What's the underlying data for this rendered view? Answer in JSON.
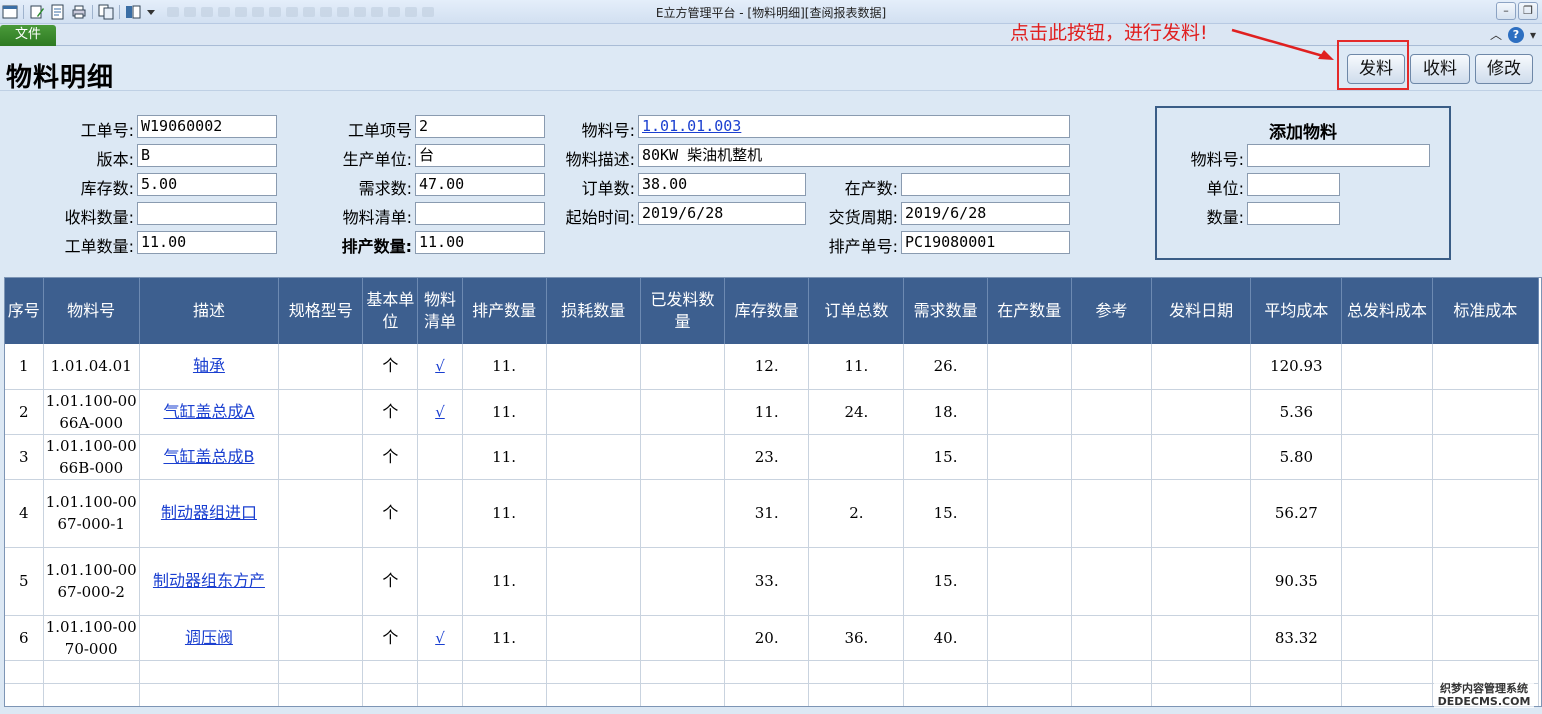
{
  "window": {
    "title": "E立方管理平台 - [物料明细][查阅报表数据]"
  },
  "ribbon": {
    "file_tab": "文件"
  },
  "page": {
    "title": "物料明细"
  },
  "annotation": {
    "text": "点击此按钮，进行发料!"
  },
  "actions": {
    "issue": "发料",
    "receive": "收料",
    "edit": "修改"
  },
  "form": {
    "work_order_no": {
      "label": "工单号:",
      "value": "W19060002"
    },
    "version": {
      "label": "版本:",
      "value": "B"
    },
    "stock_qty": {
      "label": "库存数:",
      "value": "5.00"
    },
    "received_qty": {
      "label": "收料数量:",
      "value": ""
    },
    "order_qty": {
      "label": "工单数量:",
      "value": "11.00"
    },
    "item_no": {
      "label": "工单项号",
      "value": "2"
    },
    "production_unit": {
      "label": "生产单位:",
      "value": "台"
    },
    "demand_qty": {
      "label": "需求数:",
      "value": "47.00"
    },
    "bom": {
      "label": "物料清单:",
      "value": ""
    },
    "scheduled_qty": {
      "label": "排产数量:",
      "value": "11.00"
    },
    "material_no": {
      "label": "物料号:",
      "value": "1.01.01.003"
    },
    "material_desc": {
      "label": "物料描述:",
      "value": "80KW 柴油机整机"
    },
    "order_count": {
      "label": "订单数:",
      "value": "38.00"
    },
    "start_time": {
      "label": "起始时间:",
      "value": "2019/6/28"
    },
    "in_production": {
      "label": "在产数:",
      "value": ""
    },
    "delivery": {
      "label": "交货周期:",
      "value": "2019/6/28"
    },
    "schedule_no": {
      "label": "排产单号:",
      "value": "PC19080001"
    }
  },
  "add_material": {
    "title": "添加物料",
    "material_no_label": "物料号:",
    "unit_label": "单位:",
    "qty_label": "数量:",
    "material_no": "",
    "unit": "",
    "qty": ""
  },
  "table": {
    "columns": [
      "序号",
      "物料号",
      "描述",
      "规格型号",
      "基本单位",
      "物料清单",
      "排产数量",
      "损耗数量",
      "已发料数量",
      "库存数量",
      "订单总数",
      "需求数量",
      "在产数量",
      "参考",
      "发料日期",
      "平均成本",
      "总发料成本",
      "标准成本"
    ],
    "rows": [
      {
        "seq": "1",
        "material_no": "1.01.04.01",
        "desc": "轴承",
        "spec": "",
        "unit": "个",
        "bom": "√",
        "sched": "11.",
        "loss": "",
        "issued": "",
        "stock": "12.",
        "orders": "11.",
        "demand": "26.",
        "inprod": "",
        "ref": "",
        "date": "",
        "avg": "120.93",
        "total": "",
        "std": ""
      },
      {
        "seq": "2",
        "material_no": "1.01.100-0066A-000",
        "desc": "气缸盖总成A",
        "spec": "",
        "unit": "个",
        "bom": "√",
        "sched": "11.",
        "loss": "",
        "issued": "",
        "stock": "11.",
        "orders": "24.",
        "demand": "18.",
        "inprod": "",
        "ref": "",
        "date": "",
        "avg": "5.36",
        "total": "",
        "std": ""
      },
      {
        "seq": "3",
        "material_no": "1.01.100-0066B-000",
        "desc": "气缸盖总成B",
        "spec": "",
        "unit": "个",
        "bom": "",
        "sched": "11.",
        "loss": "",
        "issued": "",
        "stock": "23.",
        "orders": "",
        "demand": "15.",
        "inprod": "",
        "ref": "",
        "date": "",
        "avg": "5.80",
        "total": "",
        "std": ""
      },
      {
        "seq": "4",
        "material_no": "1.01.100-0067-000-1",
        "desc": "制动器组进口",
        "spec": "",
        "unit": "个",
        "bom": "",
        "sched": "11.",
        "loss": "",
        "issued": "",
        "stock": "31.",
        "orders": "2.",
        "demand": "15.",
        "inprod": "",
        "ref": "",
        "date": "",
        "avg": "56.27",
        "total": "",
        "std": ""
      },
      {
        "seq": "5",
        "material_no": "1.01.100-0067-000-2",
        "desc": "制动器组东方产",
        "spec": "",
        "unit": "个",
        "bom": "",
        "sched": "11.",
        "loss": "",
        "issued": "",
        "stock": "33.",
        "orders": "",
        "demand": "15.",
        "inprod": "",
        "ref": "",
        "date": "",
        "avg": "90.35",
        "total": "",
        "std": ""
      },
      {
        "seq": "6",
        "material_no": "1.01.100-0070-000",
        "desc": "调压阀",
        "spec": "",
        "unit": "个",
        "bom": "√",
        "sched": "11.",
        "loss": "",
        "issued": "",
        "stock": "20.",
        "orders": "36.",
        "demand": "40.",
        "inprod": "",
        "ref": "",
        "date": "",
        "avg": "83.32",
        "total": "",
        "std": ""
      }
    ]
  },
  "watermark": {
    "line1": "织梦内容管理系统",
    "line2": "DEDECMS.COM"
  }
}
